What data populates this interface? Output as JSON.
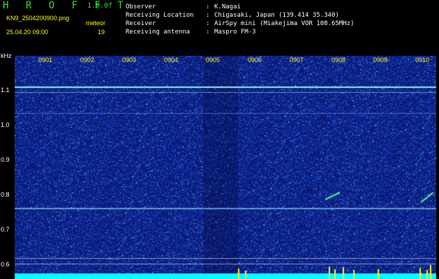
{
  "header": {
    "title": "H R O F F T",
    "version": "1.0.0f",
    "filename": "KN9_2504200900.png",
    "meteor_label": "meteor",
    "meteor_count": "19",
    "datetime": "25.04.20 09:00"
  },
  "meta": [
    {
      "key": "Observer",
      "sep": ":",
      "value": "K.Nagai"
    },
    {
      "key": "Receiving Location",
      "sep": ":",
      "value": "Chigasaki, Japan (139.414 35.340)"
    },
    {
      "key": "Receiver",
      "sep": ":",
      "value": "AirSpy mini (Miakejima VOR 108.65MHz)"
    },
    {
      "key": "Receiving antenna",
      "sep": ":",
      "value": "Maspro FM-3"
    }
  ],
  "axis": {
    "y_unit": "kHz",
    "y_ticks": [
      "1.1",
      "1.0",
      "0.9",
      "0.8",
      "0.7",
      "0.6"
    ],
    "x_ticks": [
      "0901",
      "0902",
      "0903",
      "0904",
      "0905",
      "0906",
      "0907",
      "0908",
      "0909",
      "0910"
    ]
  },
  "colors": {
    "background": "#0a1275",
    "noise_low": "#1a3cc8",
    "noise_high": "#5aa0ff",
    "cyan": "#00ffff",
    "yellow": "#ffff00",
    "green_text": "#2ee82e"
  }
}
